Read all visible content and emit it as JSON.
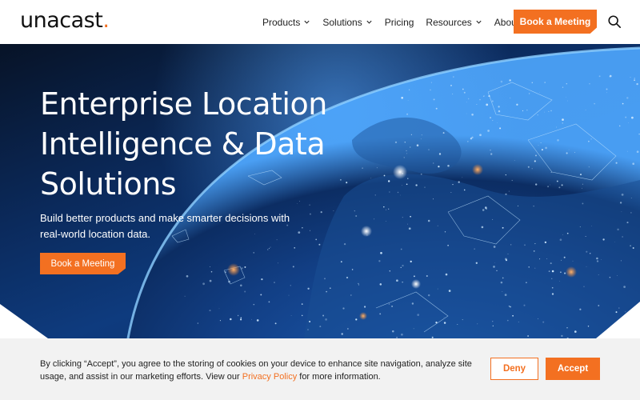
{
  "brand": {
    "name": "unacast",
    "dot": ".",
    "accent": "#f37021"
  },
  "nav": {
    "items": [
      {
        "label": "Products",
        "has_menu": true
      },
      {
        "label": "Solutions",
        "has_menu": true
      },
      {
        "label": "Pricing",
        "has_menu": false
      },
      {
        "label": "Resources",
        "has_menu": true
      },
      {
        "label": "About",
        "has_menu": true
      }
    ],
    "cta_label": "Book a Meeting",
    "search_icon": "search-icon"
  },
  "hero": {
    "title_lines": [
      "Enterprise Location",
      "Intelligence & Data",
      "Solutions"
    ],
    "subtitle": "Build better products and make smarter decisions with real-world location data.",
    "cta_label": "Book a Meeting",
    "background": "earth-at-night-europe-network"
  },
  "cookie": {
    "text_before": "By clicking “Accept”, you agree to the storing of cookies on your device to enhance site navigation, analyze site usage, and assist in our marketing efforts. View our ",
    "link_label": "Privacy Policy",
    "text_after": " for more information.",
    "deny_label": "Deny",
    "accept_label": "Accept"
  }
}
